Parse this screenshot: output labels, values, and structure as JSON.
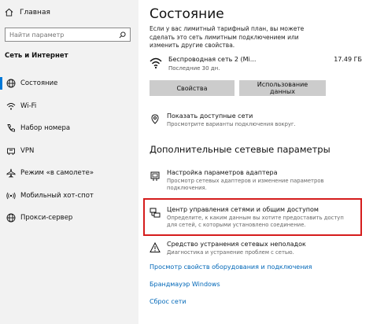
{
  "sidebar": {
    "home_label": "Главная",
    "search_placeholder": "Найти параметр",
    "section_title": "Сеть и Интернет",
    "items": [
      {
        "label": "Состояние",
        "icon": "globe-icon"
      },
      {
        "label": "Wi-Fi",
        "icon": "wifi-icon"
      },
      {
        "label": "Набор номера",
        "icon": "phone-icon"
      },
      {
        "label": "VPN",
        "icon": "vpn-icon"
      },
      {
        "label": "Режим «в самолете»",
        "icon": "airplane-icon"
      },
      {
        "label": "Мобильный хот-спот",
        "icon": "hotspot-icon"
      },
      {
        "label": "Прокси-сервер",
        "icon": "globe-icon"
      }
    ],
    "active_index": 0
  },
  "main": {
    "title": "Состояние",
    "intro": "Если у вас лимитный тарифный план, вы можете сделать это сеть лимитным подключением или изменить другие свойства.",
    "network": {
      "name": "Беспроводная сеть 2 (Mi...",
      "sub": "Последние 30 дн.",
      "size": "17.49 ГБ"
    },
    "buttons": {
      "properties": "Свойства",
      "usage": "Использование данных"
    },
    "show_networks": {
      "title": "Показать доступные сети",
      "desc": "Просмотрите варианты подключения вокруг."
    },
    "advanced_title": "Дополнительные сетевые параметры",
    "adapter": {
      "title": "Настройка параметров адаптера",
      "desc": "Просмотр сетевых адаптеров и изменение параметров подключения."
    },
    "sharing_center": {
      "title": "Центр управления сетями и общим доступом",
      "desc": "Определите, к каким данным вы хотите предоставить доступ для сетей, с которыми установлено соединение."
    },
    "troubleshoot": {
      "title": "Средство устранения сетевых неполадок",
      "desc": "Диагностика и устранение проблем с сетью."
    },
    "links": [
      "Просмотр свойств оборудования и подключения",
      "Брандмауэр Windows",
      "Сброс сети"
    ]
  },
  "colors": {
    "accent": "#0078d7",
    "link": "#0067b8",
    "highlight": "#d51c1c",
    "sidebar_bg": "#f2f2f2"
  }
}
